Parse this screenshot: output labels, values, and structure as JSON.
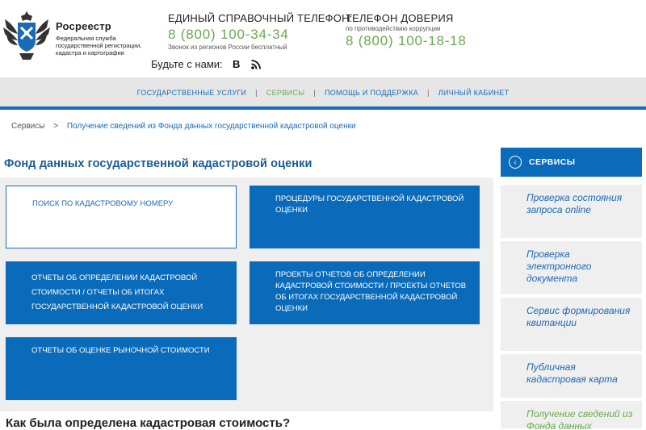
{
  "brand": {
    "name": "Росреестр",
    "subtitle": "Федеральная служба государственной регистрации, кадастра и картографии"
  },
  "phones": {
    "main": {
      "title": "ЕДИНЫЙ СПРАВОЧНЫЙ ТЕЛЕФОН:",
      "number": "8 (800) 100-34-34",
      "note": "Звонок из регионов России бесплатный"
    },
    "trust": {
      "title": "ТЕЛЕФОН ДОВЕРИЯ",
      "note": "по противодействию коррупции",
      "number": "8 (800) 100-18-18"
    }
  },
  "social": {
    "label": "Будьте с нами:",
    "vk": "В",
    "rss": "◉"
  },
  "nav": {
    "items": [
      {
        "label": "ГОСУДАРСТВЕННЫЕ УСЛУГИ"
      },
      {
        "label": "СЕРВИСЫ"
      },
      {
        "label": "ПОМОЩЬ И ПОДДЕРЖКА"
      },
      {
        "label": "ЛИЧНЫЙ КАБИНЕТ"
      }
    ],
    "separator": "|"
  },
  "breadcrumb": {
    "root": "Сервисы",
    "separator": ">",
    "current": "Получение сведений из Фонда данных государственной кадастровой оценки"
  },
  "main": {
    "title": "Фонд данных государственной кадастровой оценки",
    "tiles": [
      {
        "label": "ПОИСК ПО КАДАСТРОВОМУ НОМЕРУ"
      },
      {
        "label": "ПРОЦЕДУРЫ ГОСУДАРСТВЕННОЙ КАДАСТРОВОЙ ОЦЕНКИ"
      },
      {
        "label": "ОТЧЕТЫ ОБ ОПРЕДЕЛЕНИИ КАДАСТРОВОЙ СТОИМОСТИ / ОТЧЕТЫ ОБ ИТОГАХ ГОСУДАРСТВЕННОЙ КАДАСТРОВОЙ ОЦЕНКИ"
      },
      {
        "label": "ПРОЕКТЫ ОТЧЕТОВ ОБ ОПРЕДЕЛЕНИИ КАДАСТРОВОЙ СТОИМОСТИ / ПРОЕКТЫ ОТЧЕТОВ ОБ ИТОГАХ ГОСУДАРСТВЕННОЙ КАДАСТРОВОЙ ОЦЕНКИ"
      },
      {
        "label": "ОТЧЕТЫ ОБ ОЦЕНКЕ РЫНОЧНОЙ СТОИМОСТИ"
      }
    ],
    "section_heading": "Как была определена кадастровая стоимость?"
  },
  "sidebar": {
    "title": "СЕРВИСЫ",
    "items": [
      {
        "label": "Проверка состояния запроса online"
      },
      {
        "label": "Проверка электронного документа"
      },
      {
        "label": "Сервис формирования квитанции"
      },
      {
        "label": "Публичная кадастровая карта"
      },
      {
        "label": "Получение сведений из Фонда данных"
      }
    ]
  },
  "colors": {
    "accent_blue": "#0a6bba",
    "link_blue": "#1a6ab6",
    "accent_green": "#6aa84f",
    "panel_gray": "#efefef"
  }
}
